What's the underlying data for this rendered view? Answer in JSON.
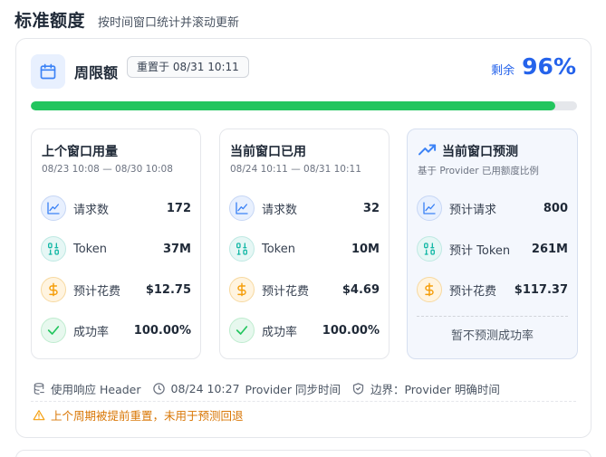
{
  "header": {
    "title": "标准额度",
    "subtitle": "按时间窗口统计并滚动更新"
  },
  "weekly": {
    "title": "周限额",
    "reset_badge": "重置于 08/31 10:11",
    "remaining_label": "剩余",
    "remaining_value": "96%",
    "progress_fraction": 0.96,
    "progress_color": "#22c55e"
  },
  "panels": [
    {
      "title": "上个窗口用量",
      "range": "08/23 10:08 — 08/30 10:08",
      "rows": [
        {
          "icon": "chart-line-icon",
          "label": "请求数",
          "value": "172"
        },
        {
          "icon": "binary-icon",
          "label": "Token",
          "value": "37M"
        },
        {
          "icon": "dollar-icon",
          "label": "预计花费",
          "value": "$12.75"
        },
        {
          "icon": "check-icon",
          "label": "成功率",
          "value": "100.00%"
        }
      ]
    },
    {
      "title": "当前窗口已用",
      "range": "08/24 10:11 — 08/31 10:11",
      "rows": [
        {
          "icon": "chart-line-icon",
          "label": "请求数",
          "value": "32"
        },
        {
          "icon": "binary-icon",
          "label": "Token",
          "value": "10M"
        },
        {
          "icon": "dollar-icon",
          "label": "预计花费",
          "value": "$4.69"
        },
        {
          "icon": "check-icon",
          "label": "成功率",
          "value": "100.00%"
        }
      ]
    },
    {
      "title": "当前窗口预测",
      "range": "基于 Provider 已用额度比例",
      "rows": [
        {
          "icon": "chart-line-icon",
          "label": "预计请求",
          "value": "800"
        },
        {
          "icon": "binary-icon",
          "label": "预计 Token",
          "value": "261M"
        },
        {
          "icon": "dollar-icon",
          "label": "预计花费",
          "value": "$117.37"
        }
      ],
      "note": "暂不预测成功率"
    }
  ],
  "meta": {
    "response_header": "使用响应 Header",
    "sync_time": "08/24 10:27",
    "sync_label": "Provider 同步时间",
    "boundary": "边界：Provider 明确时间"
  },
  "warning": "上个周期被提前重置，未用于预测回退",
  "colors": {
    "accent": "#2563eb",
    "success": "#22c55e",
    "warning": "#d97706"
  }
}
